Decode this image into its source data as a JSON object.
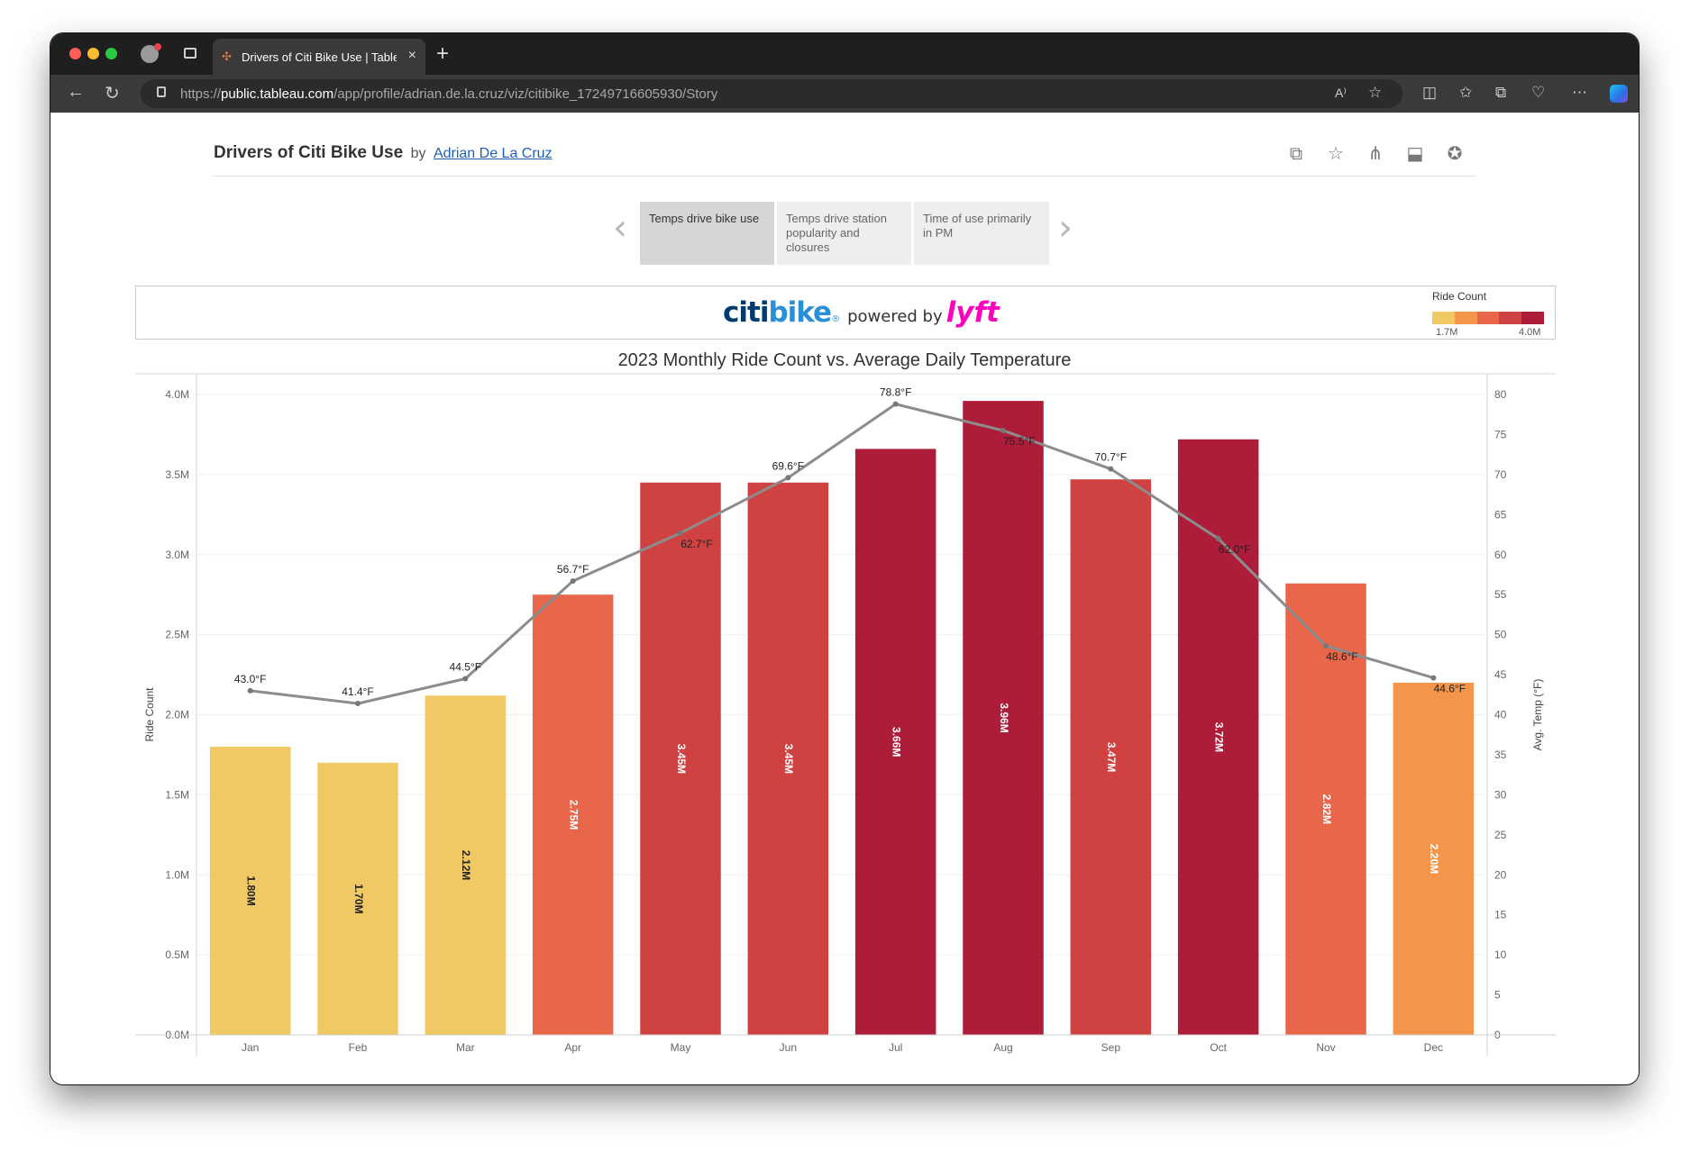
{
  "browser": {
    "tab_title": "Drivers of Citi Bike Use | Tablea",
    "tab_close": "×",
    "new_tab": "+",
    "url_prefix": "https://",
    "url_host": "public.tableau.com",
    "url_path": "/app/profile/adrian.de.la.cruz/viz/citibike_17249716605930/Story",
    "read_aloud": "A⁾"
  },
  "viz": {
    "title": "Drivers of Citi Bike Use",
    "by": "by",
    "author": "Adrian De La Cruz"
  },
  "story": {
    "points": [
      {
        "label": "Temps drive bike use",
        "active": true
      },
      {
        "label": "Temps drive station popularity and closures",
        "active": false
      },
      {
        "label": "Time of use primarily in PM",
        "active": false
      }
    ]
  },
  "logo": {
    "citi": "citi",
    "bike": "bike",
    "reg": "®",
    "powered_by": "powered by",
    "lyft": "lyft"
  },
  "legend": {
    "title": "Ride Count",
    "min_label": "1.7M",
    "max_label": "4.0M",
    "colors": [
      "#f0c965",
      "#f3954a",
      "#e8664a",
      "#d04142",
      "#ad1c38"
    ]
  },
  "chart_data": {
    "type": "bar",
    "title": "2023 Monthly Ride Count vs. Average Daily Temperature",
    "categories": [
      "Jan",
      "Feb",
      "Mar",
      "Apr",
      "May",
      "Jun",
      "Jul",
      "Aug",
      "Sep",
      "Oct",
      "Nov",
      "Dec"
    ],
    "ylabel": "Ride Count",
    "y2label": "Avg. Temp (°F)",
    "ylim": [
      0,
      4000000
    ],
    "y2lim": [
      0,
      80
    ],
    "yticks": [
      {
        "v": 0,
        "label": "0.0M"
      },
      {
        "v": 500000,
        "label": "0.5M"
      },
      {
        "v": 1000000,
        "label": "1.0M"
      },
      {
        "v": 1500000,
        "label": "1.5M"
      },
      {
        "v": 2000000,
        "label": "2.0M"
      },
      {
        "v": 2500000,
        "label": "2.5M"
      },
      {
        "v": 3000000,
        "label": "3.0M"
      },
      {
        "v": 3500000,
        "label": "3.5M"
      },
      {
        "v": 4000000,
        "label": "4.0M"
      }
    ],
    "y2ticks": [
      0,
      5,
      10,
      15,
      20,
      25,
      30,
      35,
      40,
      45,
      50,
      55,
      60,
      65,
      70,
      75,
      80
    ],
    "series": [
      {
        "name": "Ride Count",
        "kind": "bar",
        "values": [
          1800000,
          1700000,
          2120000,
          2750000,
          3450000,
          3450000,
          3660000,
          3960000,
          3470000,
          3720000,
          2820000,
          2200000
        ],
        "labels": [
          "1.80M",
          "1.70M",
          "2.12M",
          "2.75M",
          "3.45M",
          "3.45M",
          "3.66M",
          "3.96M",
          "3.47M",
          "3.72M",
          "2.82M",
          "2.20M"
        ],
        "colors": [
          "#f0c965",
          "#f0c965",
          "#f0c965",
          "#e8664a",
          "#d04142",
          "#d04142",
          "#ad1c38",
          "#ad1c38",
          "#d04142",
          "#ad1c38",
          "#e8664a",
          "#f3954a"
        ]
      },
      {
        "name": "Avg. Temp (°F)",
        "kind": "line",
        "values": [
          43.0,
          41.4,
          44.5,
          56.7,
          62.7,
          69.6,
          78.8,
          75.5,
          70.7,
          62.0,
          48.6,
          44.6
        ],
        "labels": [
          "43.0°F",
          "41.4°F",
          "44.5°F",
          "56.7°F",
          "62.7°F",
          "69.6°F",
          "78.8°F",
          "75.5°F",
          "70.7°F",
          "62.0°F",
          "48.6°F",
          "44.6°F"
        ],
        "color": "#8c8c8c"
      }
    ],
    "grid": true,
    "legend": "top-right"
  }
}
